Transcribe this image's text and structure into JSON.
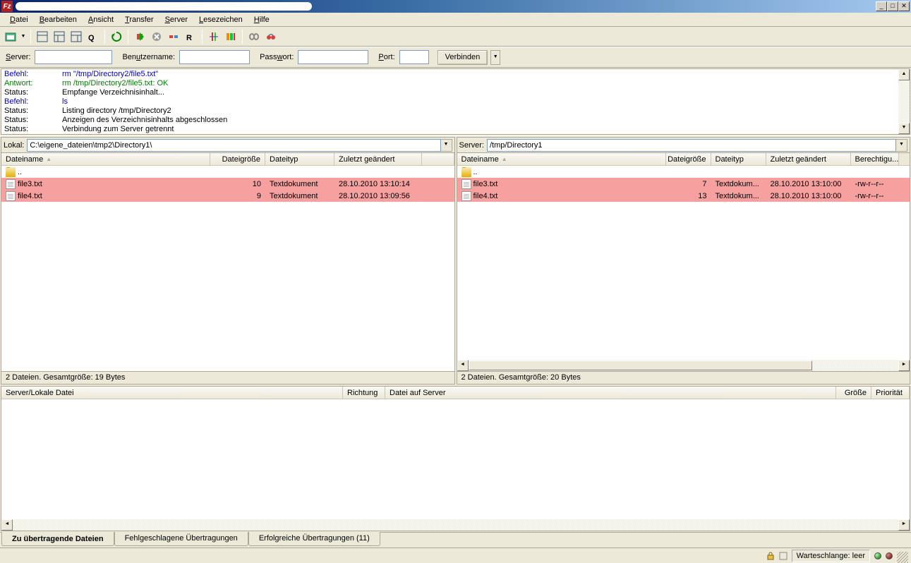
{
  "menu": {
    "file": "Datei",
    "edit": "Bearbeiten",
    "view": "Ansicht",
    "transfer": "Transfer",
    "server": "Server",
    "bookmarks": "Lesezeichen",
    "help": "Hilfe"
  },
  "quickconnect": {
    "server_label": "Server:",
    "server_value": "",
    "user_label": "Benutzername:",
    "user_value": "",
    "pass_label": "Passwort:",
    "pass_value": "",
    "port_label": "Port:",
    "port_value": "",
    "connect": "Verbinden"
  },
  "log": [
    {
      "cls": "blue",
      "label": "Befehl:",
      "text": "rm \"/tmp/Directory2/file5.txt\""
    },
    {
      "cls": "green",
      "label": "Antwort:",
      "text": "rm /tmp/Directory2/file5.txt: OK"
    },
    {
      "cls": "",
      "label": "Status:",
      "text": "Empfange Verzeichnisinhalt..."
    },
    {
      "cls": "blue",
      "label": "Befehl:",
      "text": "ls"
    },
    {
      "cls": "",
      "label": "Status:",
      "text": "Listing directory /tmp/Directory2"
    },
    {
      "cls": "",
      "label": "Status:",
      "text": "Anzeigen des Verzeichnisinhalts abgeschlossen"
    },
    {
      "cls": "",
      "label": "Status:",
      "text": "Verbindung zum Server getrennt"
    }
  ],
  "local": {
    "label": "Lokal:",
    "path": "C:\\eigene_dateien\\tmp2\\Directory1\\",
    "headers": {
      "name": "Dateiname",
      "size": "Dateigröße",
      "type": "Dateityp",
      "modified": "Zuletzt geändert"
    },
    "rows": [
      {
        "icon": "folder",
        "name": "..",
        "size": "",
        "type": "",
        "modified": "",
        "hl": false
      },
      {
        "icon": "file",
        "name": "file3.txt",
        "size": "10",
        "type": "Textdokument",
        "modified": "28.10.2010 13:10:14",
        "hl": true
      },
      {
        "icon": "file",
        "name": "file4.txt",
        "size": "9",
        "type": "Textdokument",
        "modified": "28.10.2010 13:09:56",
        "hl": true
      }
    ],
    "status": "2 Dateien. Gesamtgröße: 19 Bytes"
  },
  "remote": {
    "label": "Server:",
    "path": "/tmp/Directory1",
    "headers": {
      "name": "Dateiname",
      "size": "Dateigröße",
      "type": "Dateityp",
      "modified": "Zuletzt geändert",
      "perm": "Berechtigu..."
    },
    "rows": [
      {
        "icon": "folder",
        "name": "..",
        "size": "",
        "type": "",
        "modified": "",
        "perm": "",
        "hl": false
      },
      {
        "icon": "file",
        "name": "file3.txt",
        "size": "7",
        "type": "Textdokum...",
        "modified": "28.10.2010 13:10:00",
        "perm": "-rw-r--r--",
        "hl": true
      },
      {
        "icon": "file",
        "name": "file4.txt",
        "size": "13",
        "type": "Textdokum...",
        "modified": "28.10.2010 13:10:00",
        "perm": "-rw-r--r--",
        "hl": true
      }
    ],
    "status": "2 Dateien. Gesamtgröße: 20 Bytes"
  },
  "queue": {
    "headers": {
      "local": "Server/Lokale Datei",
      "dir": "Richtung",
      "remote": "Datei auf Server",
      "size": "Größe",
      "prio": "Priorität"
    },
    "tabs": {
      "pending": "Zu übertragende Dateien",
      "failed": "Fehlgeschlagene Übertragungen",
      "success": "Erfolgreiche Übertragungen (11)"
    }
  },
  "statusbar": {
    "queue": "Warteschlange: leer"
  }
}
